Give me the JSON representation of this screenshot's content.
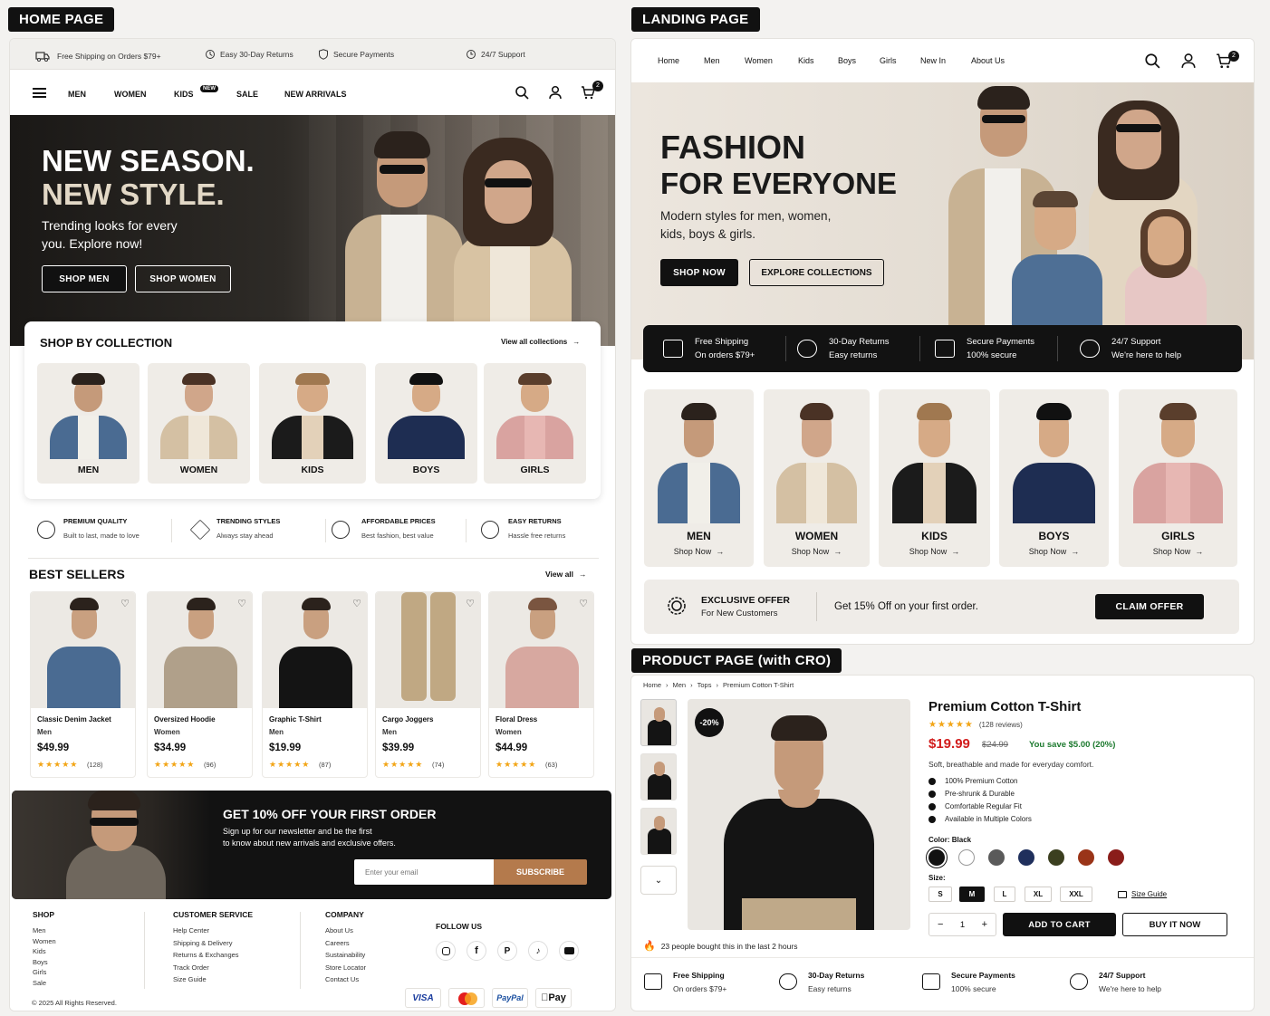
{
  "labels": {
    "home": "HOME PAGE",
    "landing": "LANDING PAGE",
    "product": "PRODUCT PAGE (with CRO)"
  },
  "home": {
    "topbar": [
      "Free Shipping on Orders $79+",
      "Easy 30-Day Returns",
      "Secure Payments",
      "24/7 Support"
    ],
    "nav": [
      "MEN",
      "WOMEN",
      "KIDS",
      "SALE",
      "NEW ARRIVALS"
    ],
    "new_badge": "NEW",
    "cart_count": "2",
    "hero": {
      "line1": "NEW SEASON.",
      "line2": "NEW STYLE.",
      "sub1": "Trending looks for every",
      "sub2": "you. Explore now!",
      "btn1": "SHOP MEN",
      "btn2": "SHOP WOMEN"
    },
    "collection": {
      "title": "SHOP BY COLLECTION",
      "view_all": "View all collections",
      "items": [
        "MEN",
        "WOMEN",
        "KIDS",
        "BOYS",
        "GIRLS"
      ]
    },
    "features": [
      {
        "t": "PREMIUM QUALITY",
        "s": "Built to last, made to love"
      },
      {
        "t": "TRENDING STYLES",
        "s": "Always stay ahead"
      },
      {
        "t": "AFFORDABLE PRICES",
        "s": "Best fashion, best value"
      },
      {
        "t": "EASY RETURNS",
        "s": "Hassle free returns"
      }
    ],
    "best": {
      "title": "BEST SELLERS",
      "view_all": "View all",
      "products": [
        {
          "name": "Classic Denim Jacket",
          "cat": "Men",
          "price": "$49.99",
          "rev": "(128)"
        },
        {
          "name": "Oversized Hoodie",
          "cat": "Women",
          "price": "$34.99",
          "rev": "(96)"
        },
        {
          "name": "Graphic T-Shirt",
          "cat": "Men",
          "price": "$19.99",
          "rev": "(87)"
        },
        {
          "name": "Cargo Joggers",
          "cat": "Men",
          "price": "$39.99",
          "rev": "(74)"
        },
        {
          "name": "Floral Dress",
          "cat": "Women",
          "price": "$44.99",
          "rev": "(63)"
        }
      ]
    },
    "newsletter": {
      "title": "GET 10% OFF YOUR FIRST ORDER",
      "s1": "Sign up for our newsletter and be the first",
      "s2": "to know about new arrivals and exclusive offers.",
      "placeholder": "Enter your email",
      "btn": "SUBSCRIBE"
    },
    "footer": {
      "shop_t": "SHOP",
      "shop": [
        "Men",
        "Women",
        "Kids",
        "Boys",
        "Girls",
        "Sale"
      ],
      "cs_t": "CUSTOMER SERVICE",
      "cs": [
        "Help Center",
        "Shipping & Delivery",
        "Returns & Exchanges",
        "Track Order",
        "Size Guide"
      ],
      "co_t": "COMPANY",
      "co": [
        "About Us",
        "Careers",
        "Sustainability",
        "Store Locator",
        "Contact Us"
      ],
      "follow": "FOLLOW US",
      "copy": "© 2025 All Rights Reserved.",
      "pay": [
        "VISA",
        "PayPal",
        "Pay"
      ]
    }
  },
  "landing": {
    "nav": [
      "Home",
      "Men",
      "Women",
      "Kids",
      "Boys",
      "Girls",
      "New In",
      "About Us"
    ],
    "cart_count": "2",
    "hero": {
      "line1": "FASHION",
      "line2": "FOR EVERYONE",
      "sub1": "Modern styles for men, women,",
      "sub2": "kids, boys & girls.",
      "btn1": "SHOP NOW",
      "btn2": "EXPLORE COLLECTIONS"
    },
    "strip": [
      {
        "t": "Free Shipping",
        "s": "On orders $79+"
      },
      {
        "t": "30-Day Returns",
        "s": "Easy returns"
      },
      {
        "t": "Secure Payments",
        "s": "100% secure"
      },
      {
        "t": "24/7 Support",
        "s": "We're here to help"
      }
    ],
    "cats": [
      "MEN",
      "WOMEN",
      "KIDS",
      "BOYS",
      "GIRLS"
    ],
    "shop_now": "Shop Now",
    "offer": {
      "t": "EXCLUSIVE OFFER",
      "s": "For New Customers",
      "msg": "Get 15% Off on your first order.",
      "btn": "CLAIM OFFER"
    }
  },
  "product": {
    "crumbs": [
      "Home",
      "Men",
      "Tops",
      "Premium Cotton T-Shirt"
    ],
    "badge": "-20%",
    "title": "Premium Cotton T-Shirt",
    "reviews": "(128 reviews)",
    "price": "$19.99",
    "old": "$24.99",
    "save": "You save $5.00 (20%)",
    "desc": "Soft, breathable and made for everyday comfort.",
    "bullets": [
      "100% Premium Cotton",
      "Pre-shrunk & Durable",
      "Comfortable Regular Fit",
      "Available in Multiple Colors"
    ],
    "color_label": "Color: Black",
    "colors": [
      "#111111",
      "#ffffff",
      "#5a5a5a",
      "#1f2f5c",
      "#3b3f1f",
      "#9a3418",
      "#8a1d1a"
    ],
    "size_label": "Size:",
    "sizes": [
      "S",
      "M",
      "L",
      "XL",
      "XXL"
    ],
    "size_guide": "Size Guide",
    "qty": "1",
    "minus": "−",
    "plus": "+",
    "add": "ADD TO CART",
    "buy": "BUY IT NOW",
    "social": "23 people bought this in the last 2 hours",
    "trust": [
      {
        "t": "Free Shipping",
        "s": "On orders $79+"
      },
      {
        "t": "30-Day Returns",
        "s": "Easy returns"
      },
      {
        "t": "Secure Payments",
        "s": "100% secure"
      },
      {
        "t": "24/7 Support",
        "s": "We're here to help"
      }
    ]
  }
}
